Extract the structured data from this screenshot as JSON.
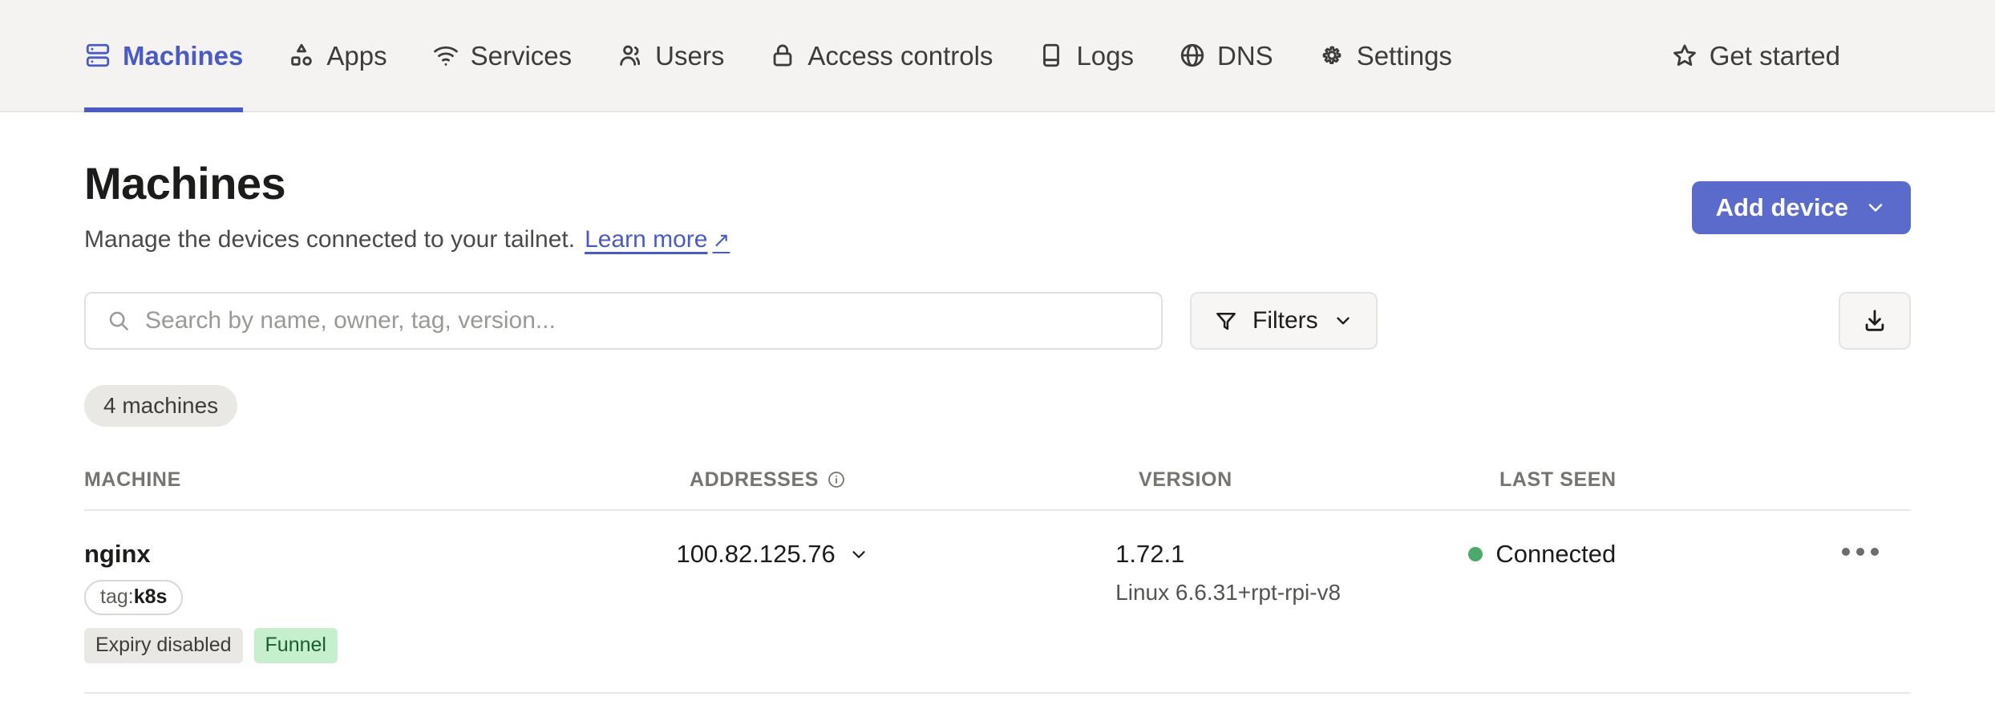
{
  "nav": {
    "items": [
      {
        "label": "Machines",
        "icon": "servers-icon",
        "active": true
      },
      {
        "label": "Apps",
        "icon": "apps-icon",
        "active": false
      },
      {
        "label": "Services",
        "icon": "wifi-icon",
        "active": false
      },
      {
        "label": "Users",
        "icon": "users-icon",
        "active": false
      },
      {
        "label": "Access controls",
        "icon": "lock-icon",
        "active": false
      },
      {
        "label": "Logs",
        "icon": "book-icon",
        "active": false
      },
      {
        "label": "DNS",
        "icon": "globe-icon",
        "active": false
      },
      {
        "label": "Settings",
        "icon": "gear-icon",
        "active": false
      }
    ],
    "get_started": {
      "label": "Get started",
      "icon": "star-icon"
    },
    "active_color": "#4B5BC4",
    "background": "#F4F3F1"
  },
  "page": {
    "title": "Machines",
    "description": "Manage the devices connected to your tailnet.",
    "learn_more": "Learn more",
    "learn_more_arrow": "↗",
    "add_device_label": "Add device",
    "add_device_color": "#5A6BCB"
  },
  "toolbar": {
    "search_placeholder": "Search by name, owner, tag, version...",
    "search_value": "",
    "filters_label": "Filters",
    "download_icon": "download-icon"
  },
  "count_chip": "4 machines",
  "table": {
    "columns": [
      {
        "key": "machine",
        "label": "MACHINE"
      },
      {
        "key": "addresses",
        "label": "ADDRESSES",
        "info_icon": true
      },
      {
        "key": "version",
        "label": "VERSION"
      },
      {
        "key": "last_seen",
        "label": "LAST SEEN"
      }
    ],
    "rows": [
      {
        "name": "nginx",
        "tag_prefix": "tag:",
        "tag_value": "k8s",
        "badges": [
          {
            "text": "Expiry disabled",
            "style": "grey"
          },
          {
            "text": "Funnel",
            "style": "green"
          }
        ],
        "address": "100.82.125.76",
        "version": "1.72.1",
        "os": "Linux 6.6.31+rpt-rpi-v8",
        "status": "Connected",
        "status_color": "#4CA96B"
      }
    ]
  }
}
